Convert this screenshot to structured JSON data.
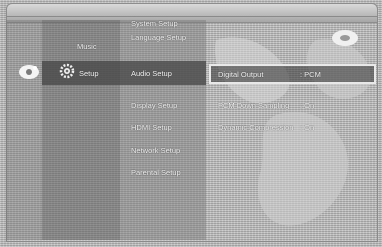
{
  "menu": {
    "categories": [
      {
        "label": "Music",
        "icon": "music-icon"
      },
      {
        "label": "Setup",
        "icon": "gear-icon"
      }
    ],
    "submenu": [
      "System Setup",
      "Language Setup",
      "Audio Setup",
      "Display Setup",
      "HDMI Setup",
      "Network Setup",
      "Parental Setup"
    ],
    "options": [
      {
        "label": "Digital Output",
        "value": ": PCM"
      },
      {
        "label": "PCM Down Sampling",
        "value": ": On"
      },
      {
        "label": "Dynamic Compression",
        "value": ": On"
      }
    ]
  }
}
